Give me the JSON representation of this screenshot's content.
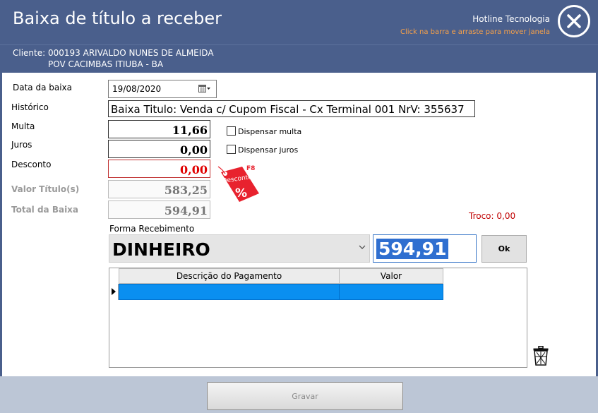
{
  "window": {
    "title": "Baixa de título a receber",
    "hotline": "Hotline Tecnologia",
    "drag_hint": "Click na barra e arraste para mover janela"
  },
  "client": {
    "label": "Cliente:",
    "name": "000193 ARIVALDO NUNES DE ALMEIDA",
    "address": "POV CACIMBAS  ITIUBA - BA"
  },
  "form": {
    "data_baixa_label": "Data da baixa",
    "data_baixa_value": "19/08/2020",
    "historico_label": "Histórico",
    "historico_value": "Baixa Titulo: Venda c/ Cupom Fiscal - Cx Terminal 001  NrV: 355637",
    "multa_label": "Multa",
    "multa_value": "11,66",
    "juros_label": "Juros",
    "juros_value": "0,00",
    "desconto_label": "Desconto",
    "desconto_value": "0,00",
    "valor_titulo_label": "Valor Título(s)",
    "valor_titulo_value": "583,25",
    "total_baixa_label": "Total da Baixa",
    "total_baixa_value": "594,91",
    "dispensar_multa_label": "Dispensar multa",
    "dispensar_juros_label": "Dispensar juros",
    "desconto_tag_text": "Desconto",
    "desconto_tag_symbol": "%",
    "desconto_tag_key": "F8",
    "troco": "Troco: 0,00"
  },
  "payment": {
    "forma_label": "Forma Recebimento",
    "forma_value": "DINHEIRO",
    "amount_value": "594,91",
    "ok_label": "Ok",
    "grid_columns": [
      "Descrição do Pagamento",
      "Valor"
    ],
    "grid_rows": [
      [
        "",
        ""
      ]
    ]
  },
  "footer": {
    "save_label": "Gravar"
  },
  "colors": {
    "header_bg": "#4a5f8c",
    "accent_orange": "#f5a04a",
    "discount_red": "#e00000",
    "selection_blue": "#0a8ff0"
  },
  "icons": [
    "close-icon",
    "calendar-icon",
    "chevron-down-icon",
    "discount-tag-icon",
    "row-indicator-icon",
    "trash-icon"
  ]
}
